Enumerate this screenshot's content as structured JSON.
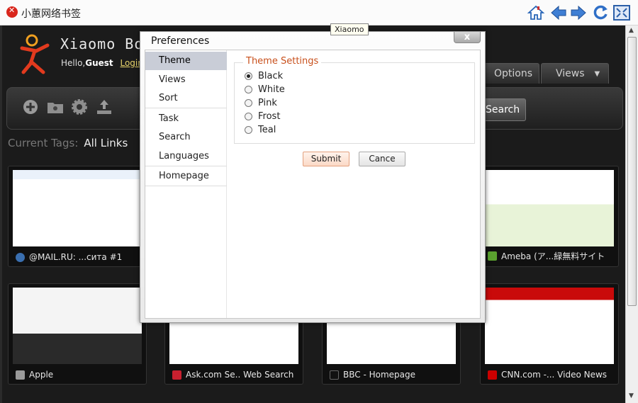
{
  "window": {
    "title": "小蕙网络书签"
  },
  "tooltip": "Xiaomo",
  "header": {
    "brand": "Xiaomo Boo",
    "hello": "Hello,",
    "user": "Guest",
    "login": "Login",
    "sep": "|",
    "more": "C"
  },
  "nav": {
    "options": "Options",
    "views": "Views"
  },
  "toolbar": {
    "search": "Search"
  },
  "tags": {
    "label": "Current Tags:",
    "value": "All Links"
  },
  "cards": [
    {
      "label": "@MAIL.RU: ...сита #1",
      "color": "#3a6fb0"
    },
    {
      "label": "Ameba (ア...緑無料サイト",
      "color": "#5aa12f"
    },
    {
      "label": "Apple",
      "color": "#999999"
    },
    {
      "label": "Ask.com Se.. Web Search",
      "color": "#c8202f"
    },
    {
      "label": "BBC - Homepage",
      "color": "#111111"
    },
    {
      "label": "CNN.com -... Video News",
      "color": "#cc0000"
    }
  ],
  "dialog": {
    "title": "Preferences",
    "close": "x",
    "menu": [
      "Theme",
      "Views",
      "Sort",
      "Task",
      "Search",
      "Languages",
      "Homepage"
    ],
    "legend": "Theme Settings",
    "options": [
      "Black",
      "White",
      "Pink",
      "Frost",
      "Teal"
    ],
    "selected": "Black",
    "submit": "Submit",
    "cancel": "Cance"
  },
  "colors": {
    "accent": "#c8501c",
    "background": "#1b1b1b"
  }
}
